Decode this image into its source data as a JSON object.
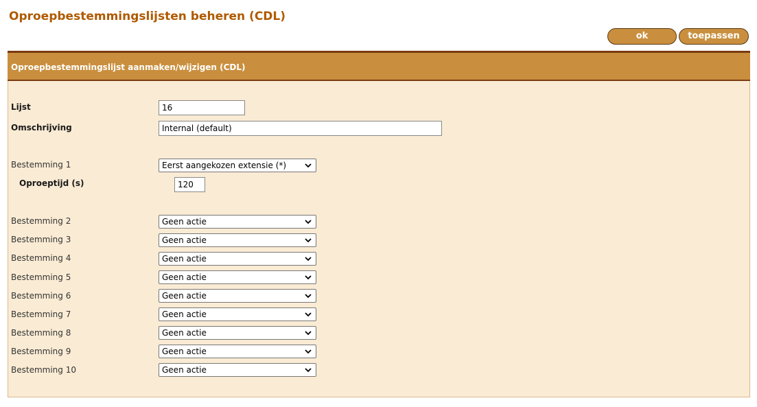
{
  "page": {
    "title": "Oproepbestemmingslijsten beheren (CDL)"
  },
  "buttons": {
    "ok": "ok",
    "apply": "toepassen"
  },
  "panel": {
    "title": "Oproepbestemmingslijst aanmaken/wijzigen (CDL)",
    "list_label": "Lijst",
    "list_value": "16",
    "description_label": "Omschrijving",
    "description_value": "Internal (default)",
    "ring_time_label": "Oproeptijd (s)",
    "ring_time_value": "120",
    "destinations": [
      {
        "label": "Bestemming 1",
        "value": "Eerst aangekozen extensie (*)"
      },
      {
        "label": "Bestemming 2",
        "value": "Geen actie"
      },
      {
        "label": "Bestemming 3",
        "value": "Geen actie"
      },
      {
        "label": "Bestemming 4",
        "value": "Geen actie"
      },
      {
        "label": "Bestemming 5",
        "value": "Geen actie"
      },
      {
        "label": "Bestemming 6",
        "value": "Geen actie"
      },
      {
        "label": "Bestemming 7",
        "value": "Geen actie"
      },
      {
        "label": "Bestemming 8",
        "value": "Geen actie"
      },
      {
        "label": "Bestemming 9",
        "value": "Geen actie"
      },
      {
        "label": "Bestemming 10",
        "value": "Geen actie"
      }
    ]
  },
  "icons": {
    "dropdown": "chevron-down-icon"
  },
  "colors": {
    "title": "#b05a00",
    "accent": "#c98f3e",
    "accent_border": "#7a3a10",
    "panel_bg": "#faebd4"
  }
}
